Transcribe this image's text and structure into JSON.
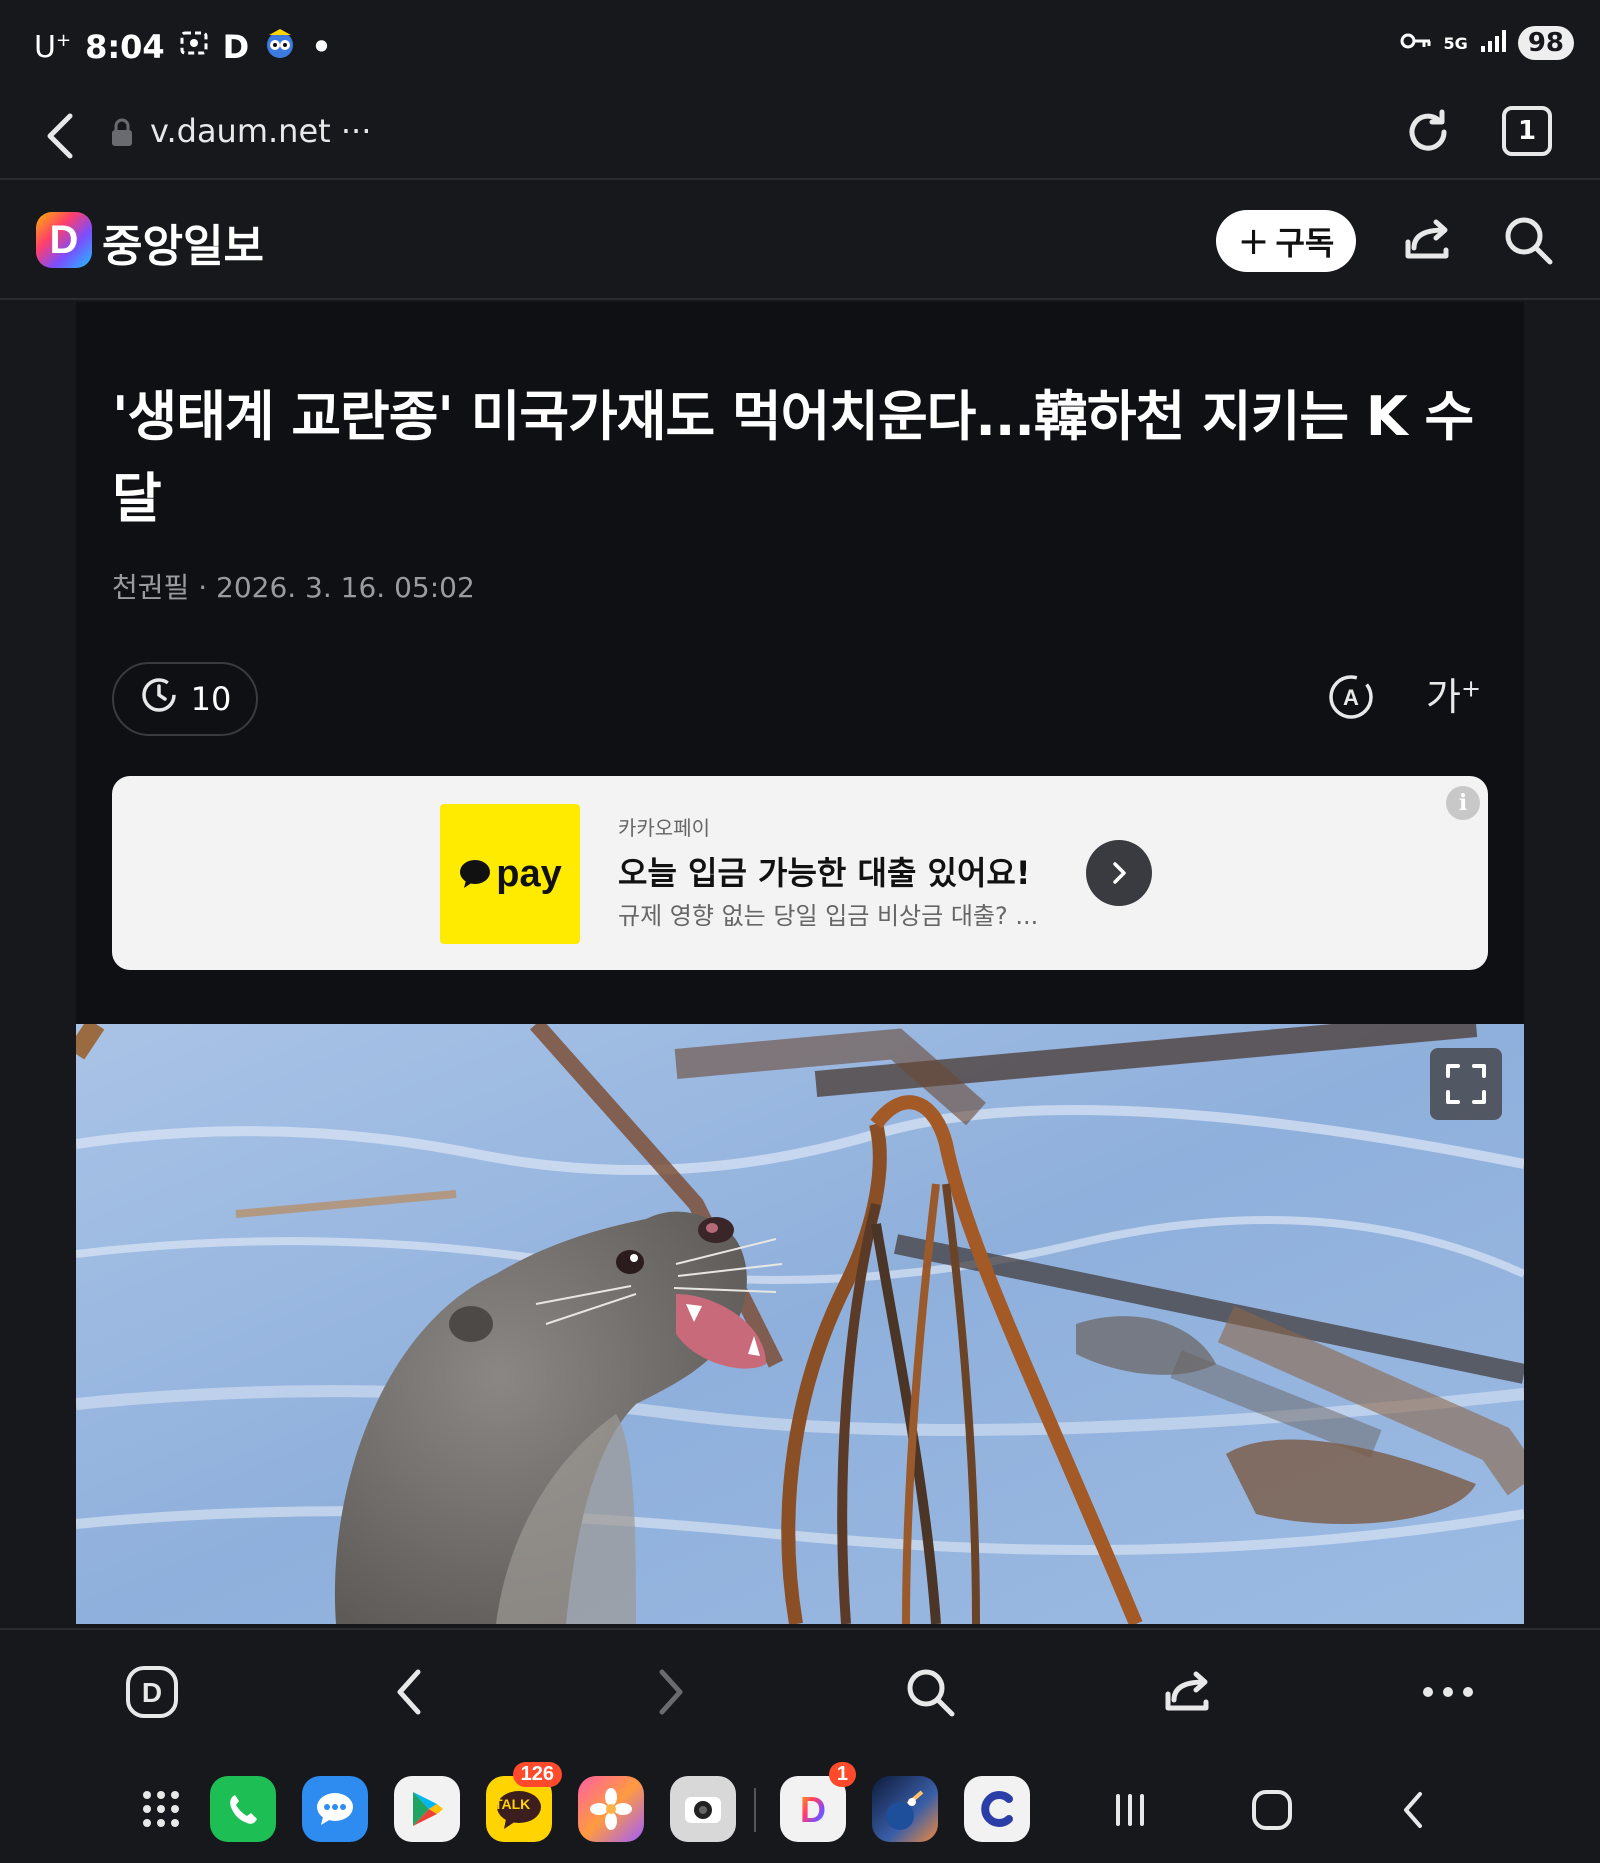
{
  "status_bar": {
    "carrier": "U",
    "carrier_sup": "+",
    "time": "8:04",
    "app_letter": "D",
    "dot": "•",
    "network": "5G",
    "battery": "98"
  },
  "url_bar": {
    "url": "v.daum.net ···",
    "tab_count": "1"
  },
  "site_header": {
    "logo_letter": "D",
    "publisher": "중앙일보",
    "subscribe_plus": "+",
    "subscribe_label": "구독"
  },
  "article": {
    "headline": "'생태계 교란종' 미국가재도 먹어치운다...韓하천 지키는 K 수달",
    "author": "천권필",
    "separator": "·",
    "date": "2026. 3. 16. 05:02",
    "reaction_count": "10",
    "font_size_label": "가",
    "font_size_sup": "+"
  },
  "ad": {
    "logo_text": "pay",
    "brand": "카카오페이",
    "title": "오늘 입금 가능한 대출 있어요!",
    "description": "규제 영향 없는 당일 입금 비상금 대출? ...",
    "info_label": "i"
  },
  "dock": {
    "kakaotalk_badge": "126",
    "daum_badge": "1",
    "kakaotalk_label": "TALK"
  },
  "colors": {
    "background": "#17181c",
    "article_bg": "#0f1014",
    "kakaopay_yellow": "#ffeb00",
    "badge_red": "#ff4b2b"
  },
  "icons": [
    "back-icon",
    "lock-icon",
    "reload-icon",
    "tabs-icon",
    "share-icon",
    "search-icon",
    "history-icon",
    "translate-icon",
    "fullscreen-icon",
    "daum-home-icon",
    "forward-icon",
    "more-icon",
    "apps-grid-icon",
    "recents-icon",
    "home-icon"
  ]
}
